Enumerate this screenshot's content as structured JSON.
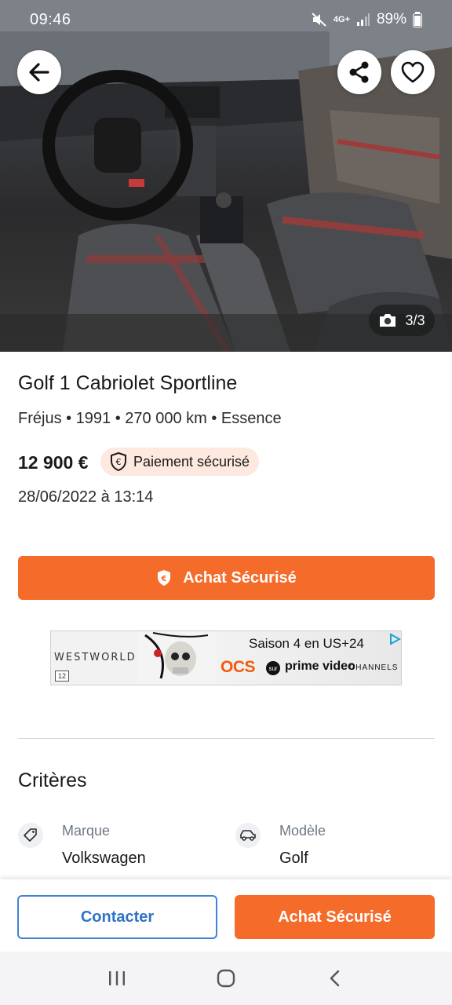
{
  "status_bar": {
    "time": "09:46",
    "network": "4G+",
    "battery": "89%"
  },
  "hero": {
    "photo_counter": "3/3",
    "icons": [
      "back-arrow-icon",
      "share-icon",
      "heart-icon",
      "camera-icon"
    ]
  },
  "listing": {
    "title": "Golf 1 Cabriolet Sportline",
    "subtitle": "Fréjus • 1991 • 270 000 km • Essence",
    "price": "12 900 €",
    "secure_badge": "Paiement sécurisé",
    "date": "28/06/2022 à 13:14",
    "cta_label": "Achat Sécurisé"
  },
  "ad": {
    "brand": "WESTWORLD",
    "rating": "12",
    "season_text": "Saison 4 en US+24",
    "ocs": "OCS",
    "sur": "sur",
    "prime": "prime video",
    "channels": "CHANNELS"
  },
  "criteria": {
    "title": "Critères",
    "items": [
      {
        "label": "Marque",
        "value": "Volkswagen",
        "icon": "tag-icon"
      },
      {
        "label": "Modèle",
        "value": "Golf",
        "icon": "car-icon"
      }
    ]
  },
  "bottom_bar": {
    "contact_label": "Contacter",
    "buy_label": "Achat Sécurisé"
  },
  "colors": {
    "accent": "#f56b2a",
    "link_blue": "#2f73c9",
    "badge_bg": "#fde9df"
  }
}
